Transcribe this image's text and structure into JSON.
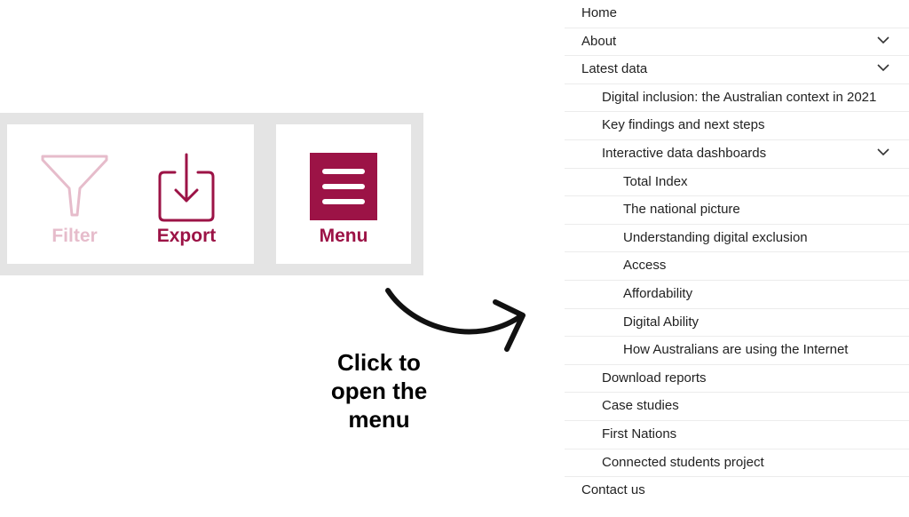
{
  "toolbar": {
    "filter_label": "Filter",
    "export_label": "Export",
    "menu_label": "Menu"
  },
  "callout": {
    "line1": "Click to",
    "line2": "open the",
    "line3": "menu"
  },
  "nav": {
    "items": [
      {
        "label": "Home"
      },
      {
        "label": "About"
      },
      {
        "label": "Latest data"
      },
      {
        "label": "Digital inclusion: the Australian context in 2021"
      },
      {
        "label": "Key findings and next steps"
      },
      {
        "label": "Interactive data dashboards"
      },
      {
        "label": "Total Index"
      },
      {
        "label": "The national picture"
      },
      {
        "label": "Understanding digital exclusion"
      },
      {
        "label": "Access"
      },
      {
        "label": "Affordability"
      },
      {
        "label": "Digital Ability"
      },
      {
        "label": "How Australians are using the Internet"
      },
      {
        "label": "Download reports"
      },
      {
        "label": "Case studies"
      },
      {
        "label": "First Nations"
      },
      {
        "label": "Connected students project"
      },
      {
        "label": "Contact us"
      }
    ]
  },
  "colors": {
    "accent": "#9c1346",
    "accent_faded": "#e6bccb",
    "panel_bg": "#e4e4e4"
  },
  "icons": {
    "filter": "funnel-icon",
    "export": "download-tray-icon",
    "menu": "hamburger-icon",
    "expand": "chevron-down-icon"
  }
}
